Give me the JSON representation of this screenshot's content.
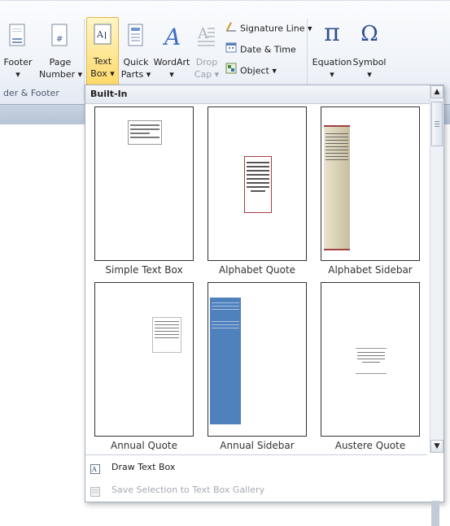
{
  "ribbon": {
    "buttons": [
      {
        "line1": "Footer",
        "line2": "▾"
      },
      {
        "line1": "Page",
        "line2": "Number ▾"
      },
      {
        "line1": "Text",
        "line2": "Box ▾"
      },
      {
        "line1": "Quick",
        "line2": "Parts ▾"
      },
      {
        "line1": "WordArt",
        "line2": "▾"
      },
      {
        "line1": "Drop",
        "line2": "Cap ▾"
      },
      {
        "line1": "Equation",
        "line2": "▾"
      },
      {
        "line1": "Symbol",
        "line2": "▾"
      }
    ],
    "small_buttons": {
      "signature_line": "Signature Line ▾",
      "date_time": "Date & Time",
      "object": "Object ▾"
    },
    "group_label": "der & Footer",
    "equation_glyph": "π",
    "symbol_glyph": "Ω"
  },
  "gallery": {
    "header": "Built-In",
    "tiles": [
      {
        "caption": "Simple Text Box"
      },
      {
        "caption": "Alphabet Quote"
      },
      {
        "caption": "Alphabet Sidebar"
      },
      {
        "caption": "Annual Quote"
      },
      {
        "caption": "Annual Sidebar"
      },
      {
        "caption": "Austere Quote"
      }
    ],
    "scroll_up": "▲",
    "scroll_down": "▼"
  },
  "menu": {
    "draw_text_box": "Draw Text Box",
    "save_selection": "Save Selection to Text Box Gallery"
  },
  "colors": {
    "active_button": "#ffd96a",
    "sidebar_blue": "#4f81bd",
    "sidebar_tan": "#d8d0b6",
    "quote_red": "#a04040"
  }
}
